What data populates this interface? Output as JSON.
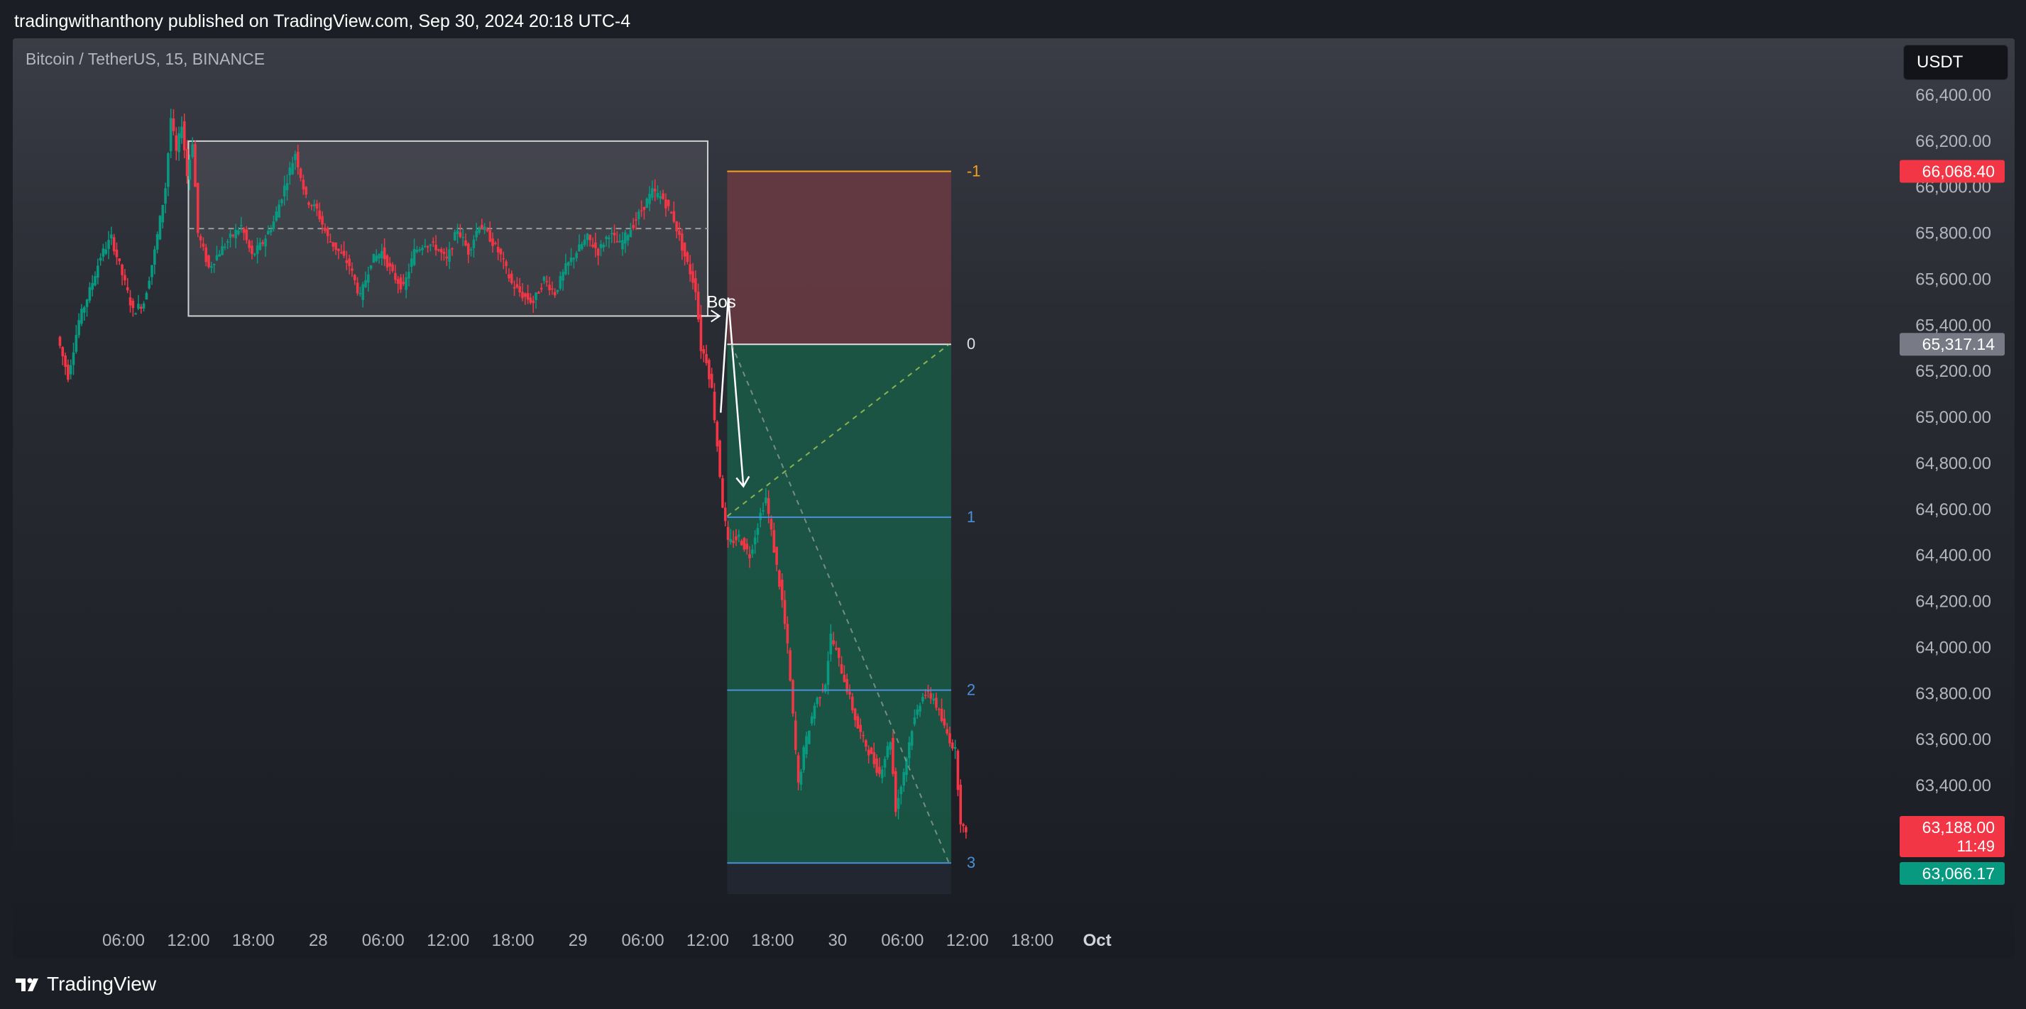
{
  "header": {
    "published_text": "tradingwithanthony published on TradingView.com, Sep 30, 2024 20:18 UTC-4"
  },
  "chart": {
    "symbol_text": "Bitcoin / TetherUS, 15, BINANCE",
    "currency": "USDT",
    "brand": "TradingView"
  },
  "chart_data": {
    "type": "candlestick",
    "symbol": "Bitcoin / TetherUS",
    "interval": "15",
    "exchange": "BINANCE",
    "y_ticks": [
      66400,
      66200,
      66000,
      65800,
      65600,
      65400,
      65200,
      65000,
      64800,
      64600,
      64400,
      64200,
      64000,
      63800,
      63600,
      63400
    ],
    "y_tick_labels": [
      "66,400.00",
      "66,200.00",
      "66,000.00",
      "65,800.00",
      "65,600.00",
      "65,400.00",
      "65,200.00",
      "65,000.00",
      "64,800.00",
      "64,600.00",
      "64,400.00",
      "64,200.00",
      "64,000.00",
      "63,800.00",
      "63,600.00",
      "63,400.00"
    ],
    "x_ticks": [
      "06:00",
      "12:00",
      "18:00",
      "28",
      "06:00",
      "12:00",
      "18:00",
      "29",
      "06:00",
      "12:00",
      "18:00",
      "30",
      "06:00",
      "12:00",
      "18:00",
      "Oct"
    ],
    "x_tick_hours": [
      6,
      12,
      18,
      24,
      30,
      36,
      42,
      48,
      54,
      60,
      66,
      72,
      78,
      84,
      90,
      96
    ],
    "price_path": [
      [
        0.0,
        65350
      ],
      [
        1.0,
        65180
      ],
      [
        2.0,
        65420
      ],
      [
        3.0,
        65550
      ],
      [
        4.0,
        65700
      ],
      [
        5.0,
        65780
      ],
      [
        6.0,
        65620
      ],
      [
        7.0,
        65460
      ],
      [
        8.0,
        65500
      ],
      [
        9.0,
        65720
      ],
      [
        10.0,
        66000
      ],
      [
        10.5,
        66300
      ],
      [
        11.0,
        66150
      ],
      [
        11.5,
        66280
      ],
      [
        12.0,
        66050
      ],
      [
        12.5,
        66200
      ],
      [
        13.0,
        65800
      ],
      [
        14.0,
        65650
      ],
      [
        15.0,
        65720
      ],
      [
        16.0,
        65780
      ],
      [
        17.0,
        65830
      ],
      [
        18.0,
        65700
      ],
      [
        19.0,
        65760
      ],
      [
        20.0,
        65850
      ],
      [
        21.0,
        66000
      ],
      [
        22.0,
        66150
      ],
      [
        23.0,
        65950
      ],
      [
        24.0,
        65900
      ],
      [
        25.0,
        65780
      ],
      [
        26.0,
        65720
      ],
      [
        27.0,
        65660
      ],
      [
        28.0,
        65520
      ],
      [
        29.0,
        65680
      ],
      [
        30.0,
        65720
      ],
      [
        31.0,
        65620
      ],
      [
        32.0,
        65560
      ],
      [
        33.0,
        65720
      ],
      [
        34.0,
        65760
      ],
      [
        35.0,
        65740
      ],
      [
        36.0,
        65680
      ],
      [
        37.0,
        65820
      ],
      [
        38.0,
        65720
      ],
      [
        39.0,
        65840
      ],
      [
        40.0,
        65780
      ],
      [
        41.0,
        65700
      ],
      [
        42.0,
        65580
      ],
      [
        43.0,
        65530
      ],
      [
        44.0,
        65500
      ],
      [
        45.0,
        65600
      ],
      [
        46.0,
        65540
      ],
      [
        47.0,
        65650
      ],
      [
        48.0,
        65720
      ],
      [
        49.0,
        65780
      ],
      [
        50.0,
        65720
      ],
      [
        51.0,
        65800
      ],
      [
        52.0,
        65750
      ],
      [
        53.0,
        65820
      ],
      [
        54.0,
        65900
      ],
      [
        55.0,
        65980
      ],
      [
        56.0,
        65950
      ],
      [
        57.0,
        65860
      ],
      [
        58.0,
        65700
      ],
      [
        59.0,
        65560
      ],
      [
        59.5,
        65300
      ],
      [
        60.0,
        65250
      ],
      [
        60.5,
        65120
      ],
      [
        61.0,
        64880
      ],
      [
        61.5,
        64620
      ],
      [
        62.0,
        64450
      ],
      [
        63.0,
        64480
      ],
      [
        64.0,
        64400
      ],
      [
        65.0,
        64580
      ],
      [
        65.5,
        64650
      ],
      [
        66.0,
        64500
      ],
      [
        66.5,
        64350
      ],
      [
        67.0,
        64200
      ],
      [
        67.5,
        64000
      ],
      [
        68.0,
        63700
      ],
      [
        68.5,
        63400
      ],
      [
        69.0,
        63550
      ],
      [
        69.5,
        63650
      ],
      [
        70.0,
        63750
      ],
      [
        71.0,
        63850
      ],
      [
        71.5,
        64050
      ],
      [
        72.0,
        63980
      ],
      [
        73.0,
        63820
      ],
      [
        74.0,
        63650
      ],
      [
        75.0,
        63550
      ],
      [
        76.0,
        63450
      ],
      [
        77.0,
        63600
      ],
      [
        77.5,
        63300
      ],
      [
        78.0,
        63400
      ],
      [
        79.0,
        63650
      ],
      [
        80.0,
        63800
      ],
      [
        81.0,
        63780
      ],
      [
        82.0,
        63650
      ],
      [
        83.0,
        63550
      ],
      [
        83.5,
        63250
      ],
      [
        84.0,
        63180
      ]
    ],
    "rectangle_range": {
      "start_hour": 12,
      "end_hour": 60,
      "top": 66200,
      "bottom": 65440,
      "mid": 65820
    },
    "annotation": "Bos",
    "fib_levels": [
      {
        "label": "-1",
        "price": 66068.4
      },
      {
        "label": "0",
        "price": 65317.14
      },
      {
        "label": "1",
        "price": 64565.88
      },
      {
        "label": "2",
        "price": 63814.62
      },
      {
        "label": "3",
        "price": 63063.36
      }
    ],
    "price_badges": [
      {
        "text": "66,068.40",
        "color": "#f23645"
      },
      {
        "text": "65,317.14",
        "color": "#787b86"
      },
      {
        "text": "63,188.00",
        "sub": "11:49",
        "color": "#f23645"
      },
      {
        "text": "63,066.17",
        "color": "#089981"
      }
    ],
    "colors": {
      "up": "#089981",
      "down": "#f23645",
      "fib_neg": "#f7a21b",
      "fib_level": "#4a90d9",
      "stop_zone": "#6b3b42",
      "target_zone": "#1a5c48"
    },
    "last_price": 63188.0,
    "countdown": "11:49"
  }
}
